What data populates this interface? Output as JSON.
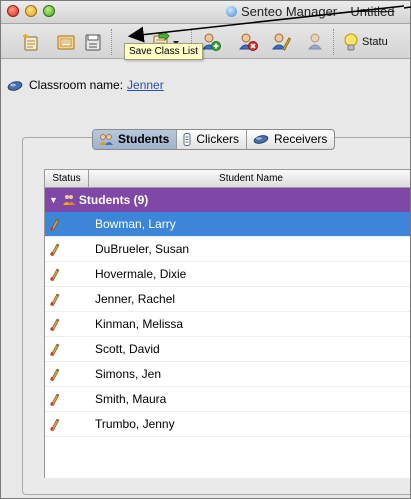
{
  "window": {
    "title_app": "Senteo Manager",
    "title_sep": "–",
    "title_doc": "Untitled"
  },
  "toolbar": {
    "buttons": [
      "new-class-icon",
      "open-class-icon",
      "save-class-list-icon",
      "export-icon",
      "add-student-icon",
      "remove-student-icon",
      "edit-student-icon",
      "student-info-icon",
      "lightbulb-icon"
    ],
    "status_label": "Statu"
  },
  "tooltip": {
    "text": "Save Class List"
  },
  "classroom": {
    "label": "Classroom name:",
    "value": "Jenner"
  },
  "tabs": [
    {
      "label": "Students",
      "icon": "students-icon",
      "active": true
    },
    {
      "label": "Clickers",
      "icon": "clicker-icon",
      "active": false
    },
    {
      "label": "Receivers",
      "icon": "receiver-icon",
      "active": false
    }
  ],
  "table": {
    "columns": [
      "Status",
      "Student Name"
    ],
    "group_label": "Students (9)",
    "rows": [
      {
        "name": "Bowman, Larry",
        "selected": true
      },
      {
        "name": "DuBrueler, Susan",
        "selected": false
      },
      {
        "name": "Hovermale, Dixie",
        "selected": false
      },
      {
        "name": "Jenner, Rachel",
        "selected": false
      },
      {
        "name": "Kinman, Melissa",
        "selected": false
      },
      {
        "name": "Scott, David",
        "selected": false
      },
      {
        "name": "Simons, Jen",
        "selected": false
      },
      {
        "name": "Smith, Maura",
        "selected": false
      },
      {
        "name": "Trumbo, Jenny",
        "selected": false
      }
    ]
  },
  "colors": {
    "group_header": "#8048a6",
    "selection": "#3b86d8",
    "tooltip_bg": "#ffffc6"
  }
}
